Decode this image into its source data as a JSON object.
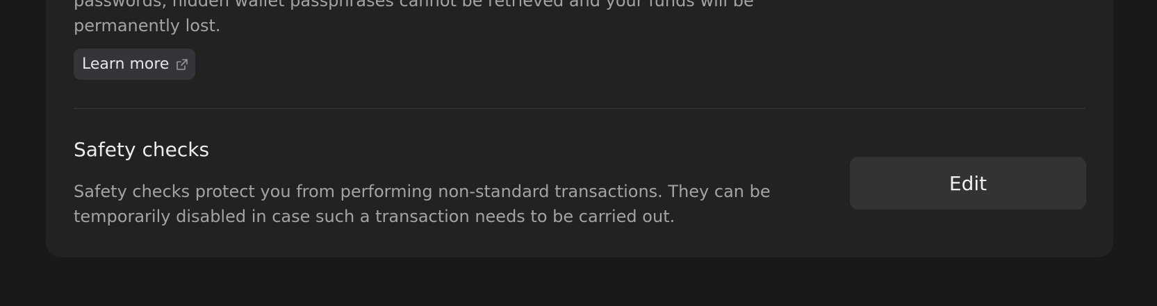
{
  "top_section": {
    "cut_text": "passwords, hidden wallet passphrases cannot be retrieved and your funds will be permanently lost.",
    "learn_more_label": "Learn more",
    "learn_more_icon": "external-link-icon"
  },
  "safety_checks": {
    "title": "Safety checks",
    "description": "Safety checks protect you from performing non-standard transactions. They can be temporarily disabled in case such a transaction needs to be carried out.",
    "edit_label": "Edit"
  },
  "colors": {
    "page_bg": "#18191b",
    "card_bg": "#222223",
    "button_bg": "#323335",
    "secondary_text": "#a3a3a3",
    "primary_text": "#ececec"
  }
}
